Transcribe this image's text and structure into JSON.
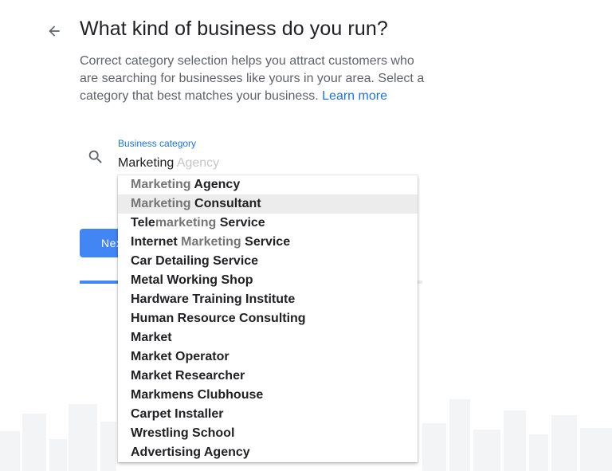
{
  "header": {
    "title": "What kind of business do you run?",
    "back_icon": "arrow-back-icon"
  },
  "description": {
    "text": "Correct category selection helps you attract customers who are searching for businesses like yours in your area. Select a category that best matches your business. ",
    "learn_more": "Learn more"
  },
  "form": {
    "search_icon": "search-icon",
    "label": "Business category",
    "typed_value": "Marketing",
    "autocomplete_hint": " Agency",
    "next_button": "Next"
  },
  "progress": {
    "value": 0.2
  },
  "suggestions": {
    "highlighted_index": 1,
    "items": [
      [
        {
          "t": "Marketing",
          "m": true
        },
        {
          "t": " Agency",
          "m": false
        }
      ],
      [
        {
          "t": "Marketing",
          "m": true
        },
        {
          "t": " Consultant",
          "m": false
        }
      ],
      [
        {
          "t": "Tele",
          "m": false
        },
        {
          "t": "marketing",
          "m": true
        },
        {
          "t": " Service",
          "m": false
        }
      ],
      [
        {
          "t": "Internet ",
          "m": false
        },
        {
          "t": "Marketing",
          "m": true
        },
        {
          "t": " Service",
          "m": false
        }
      ],
      [
        {
          "t": "Car Detailing Service",
          "m": false
        }
      ],
      [
        {
          "t": "Metal Working Shop",
          "m": false
        }
      ],
      [
        {
          "t": "Hardware Training Institute",
          "m": false
        }
      ],
      [
        {
          "t": "Human Resource Consulting",
          "m": false
        }
      ],
      [
        {
          "t": "Market",
          "m": false
        }
      ],
      [
        {
          "t": "Market Operator",
          "m": false
        }
      ],
      [
        {
          "t": "Market Researcher",
          "m": false
        }
      ],
      [
        {
          "t": "Markmens Clubhouse",
          "m": false
        }
      ],
      [
        {
          "t": "Carpet Installer",
          "m": false
        }
      ],
      [
        {
          "t": "Wrestling School",
          "m": false
        }
      ],
      [
        {
          "t": "Advertising Agency",
          "m": false
        }
      ]
    ]
  },
  "colors": {
    "accent": "#1a73e8",
    "button": "#4285f4",
    "match_text": "#757575",
    "highlight_row": "#ececec"
  }
}
